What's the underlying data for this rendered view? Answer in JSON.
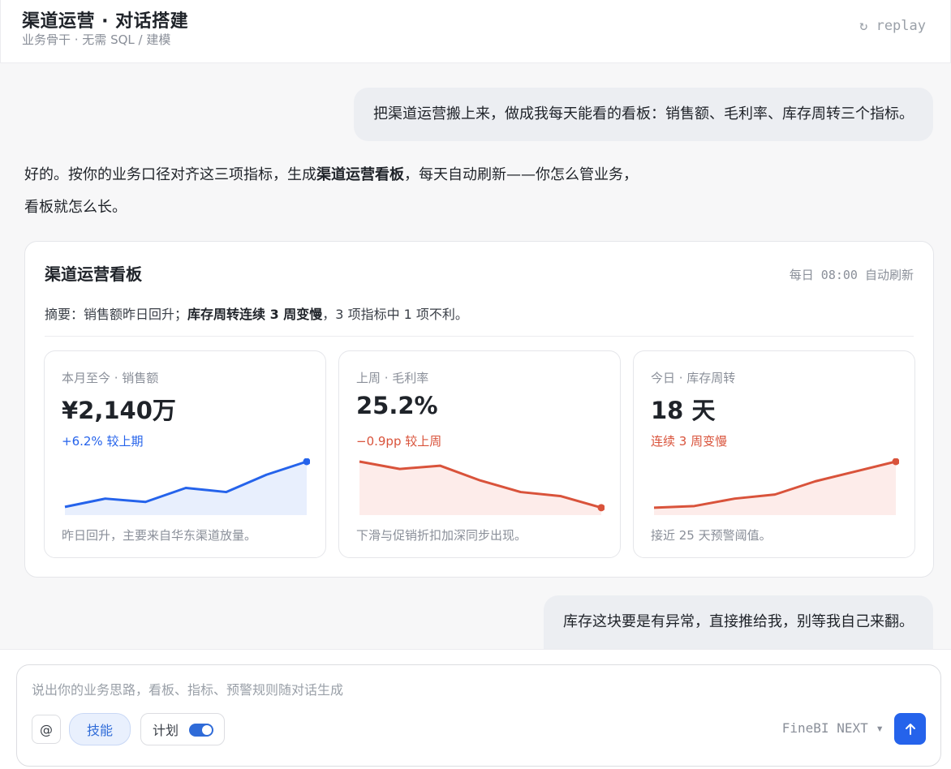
{
  "header": {
    "title": "渠道运营 · 对话搭建",
    "subtitle": "业务骨干 · 无需 SQL / 建模",
    "replay_label": "↻ replay"
  },
  "chat": {
    "user_message_1": "把渠道运营搬上来，做成我每天能看的看板：销售额、毛利率、库存周转三个指标。",
    "assistant_line1_prefix": "好的。按你的业务口径对齐这三项指标，生成",
    "assistant_line1_bold": "渠道运营看板",
    "assistant_line1_suffix": "，每天自动刷新——你怎么管业务，",
    "assistant_line2": "看板就怎么长。",
    "user_message_2": "库存这块要是有异常，直接推给我，别等我自己来翻。"
  },
  "dashboard": {
    "title": "渠道运营看板",
    "refresh": "每日 08:00 自动刷新",
    "summary_prefix": "摘要：销售额昨日回升；",
    "summary_bold": "库存周转连续 3 周变慢",
    "summary_suffix": "，3 项指标中 1 项不利。",
    "metrics": [
      {
        "label": "本月至今 · 销售额",
        "value": "¥2,140万",
        "delta": "+6.2% 较上期",
        "note": "昨日回升，主要来自华东渠道放量。",
        "color": "#2563eb",
        "fill": "#e8effd"
      },
      {
        "label": "上周 · 毛利率",
        "value": "25.2%",
        "delta": "−0.9pp 较上周",
        "note": "下滑与促销折扣加深同步出现。",
        "color": "#d9533b",
        "fill": "#fdecea"
      },
      {
        "label": "今日 · 库存周转",
        "value": "18 天",
        "delta": "连续 3 周变慢",
        "note": "接近 25 天预警阈值。",
        "color": "#d9533b",
        "fill": "#fdecea"
      }
    ]
  },
  "chart_data": [
    {
      "type": "area",
      "series": [
        {
          "values": [
            1.0,
            2.0,
            1.6,
            3.3,
            2.8,
            4.9,
            6.5
          ]
        }
      ]
    },
    {
      "type": "area",
      "series": [
        {
          "values": [
            6.5,
            5.6,
            6.0,
            4.2,
            2.8,
            2.3,
            0.9
          ]
        }
      ]
    },
    {
      "type": "area",
      "series": [
        {
          "values": [
            0.9,
            1.1,
            2.0,
            2.5,
            4.1,
            5.3,
            6.5
          ]
        }
      ]
    }
  ],
  "composer": {
    "placeholder": "说出你的业务思路，看板、指标、预警规则随对话生成",
    "at_label": "@",
    "skill_label": "技能",
    "plan_label": "计划",
    "model_label": "FineBI NEXT ▾",
    "send_icon": "arrow-up-icon"
  }
}
